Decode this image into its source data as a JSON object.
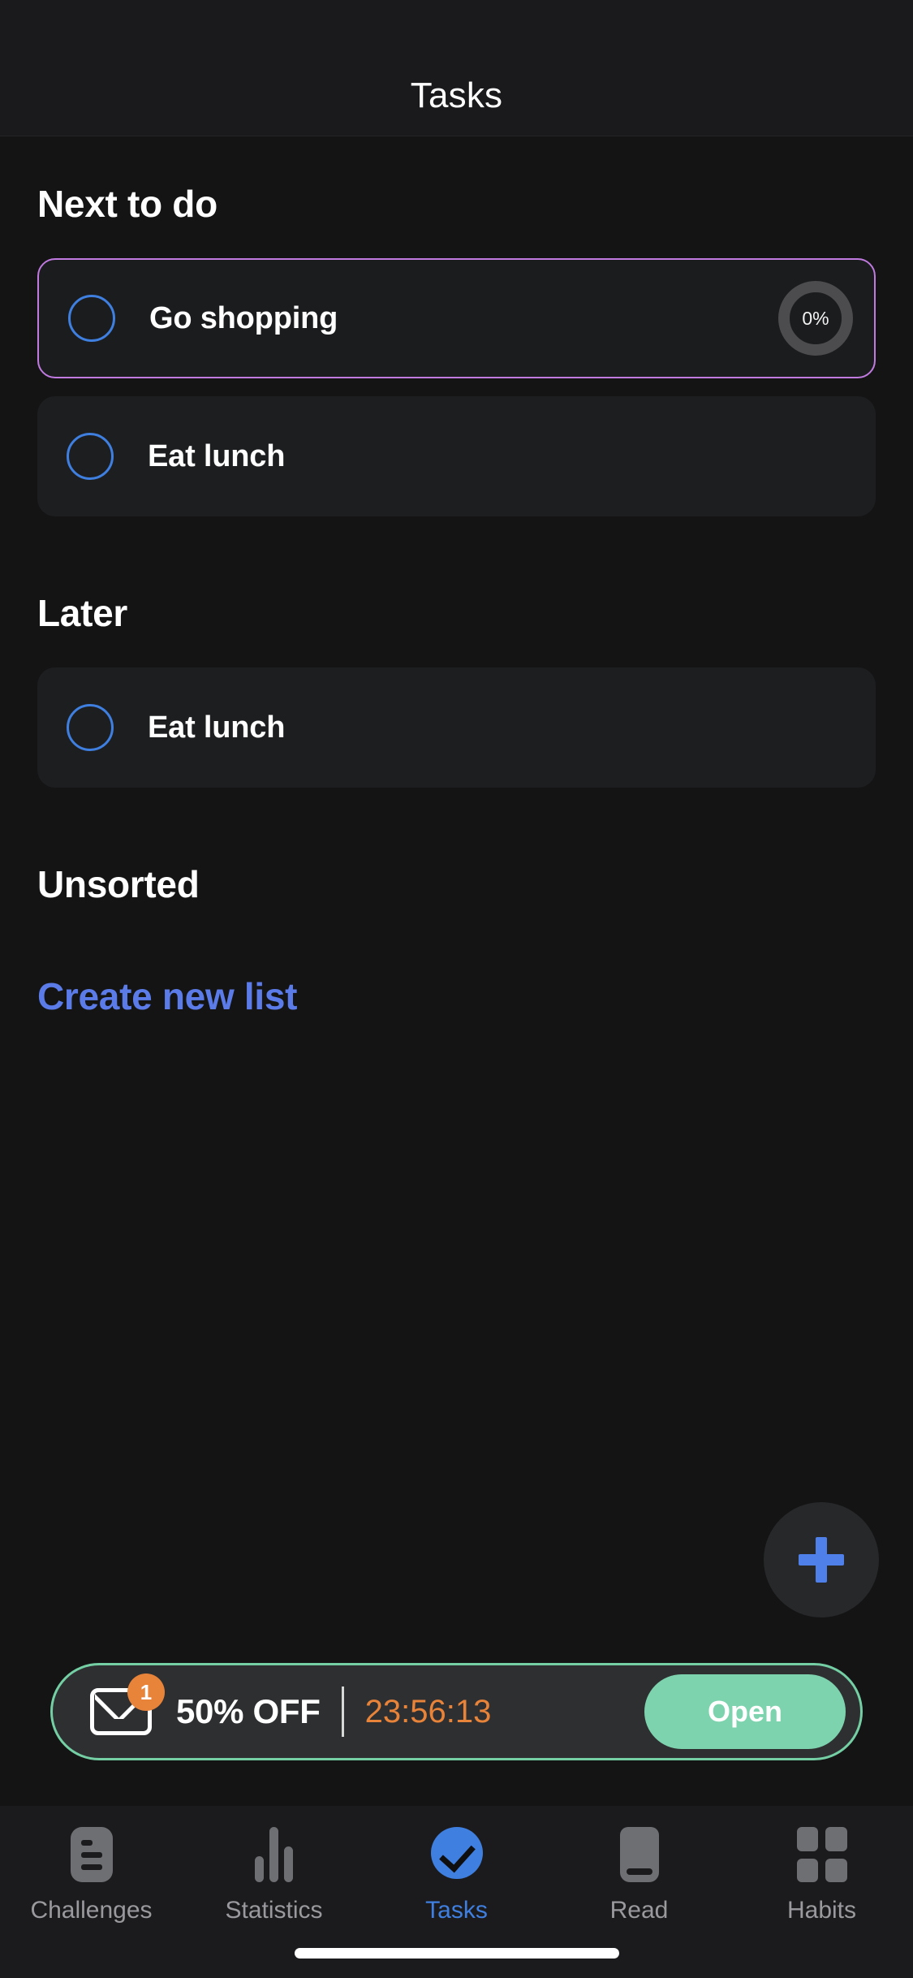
{
  "header": {
    "title": "Tasks"
  },
  "sections": [
    {
      "id": "next",
      "title": "Next to do"
    },
    {
      "id": "later",
      "title": "Later"
    },
    {
      "id": "unsorted",
      "title": "Unsorted"
    }
  ],
  "tasks_next": [
    {
      "title": "Go shopping",
      "progress": "0%",
      "selected": true
    },
    {
      "title": "Eat lunch",
      "selected": false
    }
  ],
  "tasks_later": [
    {
      "title": "Eat lunch",
      "selected": false
    }
  ],
  "create_list_label": "Create new list",
  "fab": {
    "icon": "plus-icon"
  },
  "promo": {
    "badge_count": "1",
    "offer": "50% OFF",
    "timer": "23:56:13",
    "button_label": "Open",
    "accent": "#7dd3ae",
    "timer_color": "#e8833a"
  },
  "tabbar": {
    "items": [
      {
        "label": "Challenges",
        "icon": "challenges-icon",
        "active": false
      },
      {
        "label": "Statistics",
        "icon": "statistics-icon",
        "active": false
      },
      {
        "label": "Tasks",
        "icon": "tasks-check-icon",
        "active": true
      },
      {
        "label": "Read",
        "icon": "book-icon",
        "active": false
      },
      {
        "label": "Habits",
        "icon": "grid-icon",
        "active": false
      }
    ]
  },
  "colors": {
    "page_bg": "#141415",
    "card_bg": "#1d1e20",
    "accent_blue": "#3f7fe0",
    "link_blue": "#5b7ce8",
    "selected_border": "#c07ae0",
    "promo_green": "#7dd3ae",
    "orange": "#e8833a"
  }
}
